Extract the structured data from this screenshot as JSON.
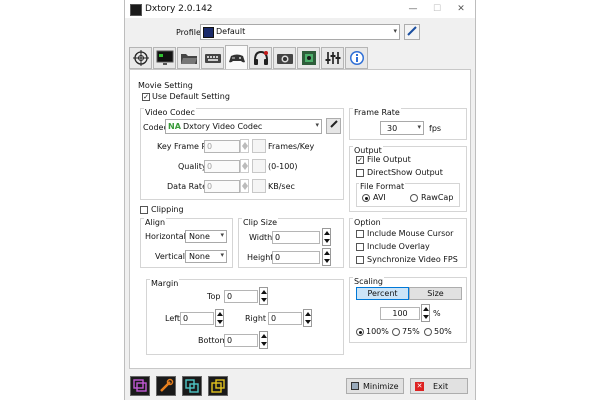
{
  "window": {
    "title": "Dxtory 2.0.142",
    "minimize_glyph": "—",
    "maximize_glyph": "☐",
    "close_glyph": "✕"
  },
  "profile": {
    "label": "Profile",
    "value": "Default"
  },
  "tabs": [
    "crosshair-icon",
    "monitor-icon",
    "folder-icon",
    "keyboard-icon",
    "gamepad-icon",
    "headphones-icon",
    "camera-icon",
    "chip-icon",
    "sliders-icon",
    "info-icon"
  ],
  "movie_setting": {
    "title": "Movie Setting",
    "use_default": "Use Default Setting",
    "video_codec": {
      "title": "Video Codec",
      "codec_label": "Codec",
      "codec_badge": "NA",
      "codec_value": "Dxtory Video Codec",
      "key_frame_label": "Key Frame Rate",
      "key_frame_value": "0",
      "key_frame_unit": "Frames/Key",
      "quality_label": "Quality",
      "quality_value": "0",
      "quality_unit": "(0-100)",
      "data_rate_label": "Data Rate",
      "data_rate_value": "0",
      "data_rate_unit": "KB/sec"
    },
    "frame_rate": {
      "title": "Frame Rate",
      "value": "30",
      "unit": "fps"
    },
    "clipping": {
      "label": "Clipping",
      "align_title": "Align",
      "horizontal_label": "Horizontal",
      "horizontal_value": "None",
      "vertical_label": "Vertical",
      "vertical_value": "None",
      "clip_size_title": "Clip Size",
      "width_label": "Width",
      "width_value": "0",
      "height_label": "Height",
      "height_value": "0",
      "margin_title": "Margin",
      "top_label": "Top",
      "top_value": "0",
      "left_label": "Left",
      "left_value": "0",
      "right_label": "Right",
      "right_value": "0",
      "bottom_label": "Bottom",
      "bottom_value": "0"
    },
    "output": {
      "title": "Output",
      "file_output": "File Output",
      "directshow_output": "DirectShow Output",
      "file_format_title": "File Format",
      "avi": "AVI",
      "rawcap": "RawCap"
    },
    "option": {
      "title": "Option",
      "include_mouse": "Include Mouse Cursor",
      "include_overlay": "Include Overlay",
      "sync_fps": "Synchronize Video FPS"
    },
    "scaling": {
      "title": "Scaling",
      "percent_btn": "Percent",
      "size_btn": "Size",
      "value": "100",
      "unit": "%",
      "r100": "100%",
      "r75": "75%",
      "r50": "50%"
    }
  },
  "bottom": {
    "minimize": "Minimize",
    "exit": "Exit"
  },
  "colors": {
    "accent": "#cce4f7",
    "codec_green": "#3a9b3a",
    "tab_selected": "#fafafa"
  }
}
